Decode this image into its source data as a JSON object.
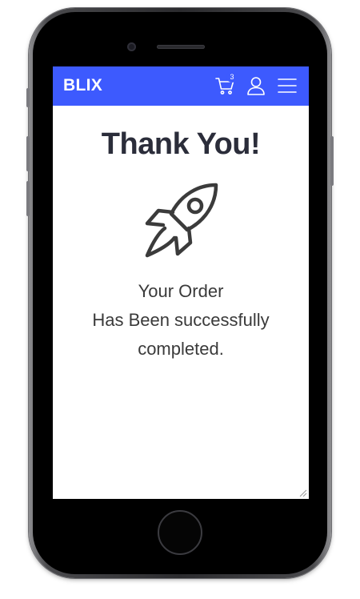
{
  "navbar": {
    "brand": "BLIX",
    "cart_count": "3",
    "icons": [
      "cart-icon",
      "user-icon",
      "menu-icon"
    ],
    "color": "#3d5afe"
  },
  "main": {
    "title": "Thank You!",
    "icon": "rocket-icon",
    "message_lines": [
      "Your Order",
      "Has Been successfully",
      "completed."
    ]
  },
  "colors": {
    "title": "#2b2d3a",
    "text": "#3a3a3a",
    "screen_bg": "#ffffff"
  }
}
